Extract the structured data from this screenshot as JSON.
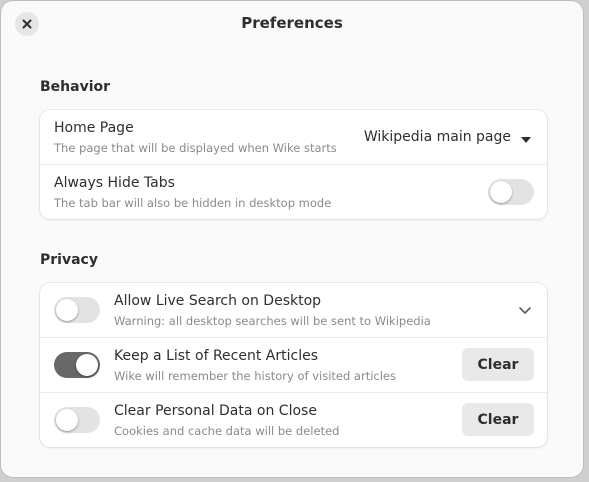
{
  "window": {
    "title": "Preferences"
  },
  "behavior": {
    "heading": "Behavior",
    "home_page": {
      "title": "Home Page",
      "subtitle": "The page that will be displayed when Wike starts",
      "value": "Wikipedia main page"
    },
    "hide_tabs": {
      "title": "Always Hide Tabs",
      "subtitle": "The tab bar will also be hidden in desktop mode",
      "enabled": false
    }
  },
  "privacy": {
    "heading": "Privacy",
    "live_search": {
      "title": "Allow Live Search on Desktop",
      "subtitle": "Warning: all desktop searches will be sent to Wikipedia",
      "enabled": false
    },
    "recent_articles": {
      "title": "Keep a List of Recent Articles",
      "subtitle": "Wike will remember the history of visited articles",
      "enabled": true,
      "button_label": "Clear"
    },
    "clear_on_close": {
      "title": "Clear Personal Data on Close",
      "subtitle": "Cookies and cache data will be deleted",
      "enabled": false,
      "button_label": "Clear"
    }
  }
}
